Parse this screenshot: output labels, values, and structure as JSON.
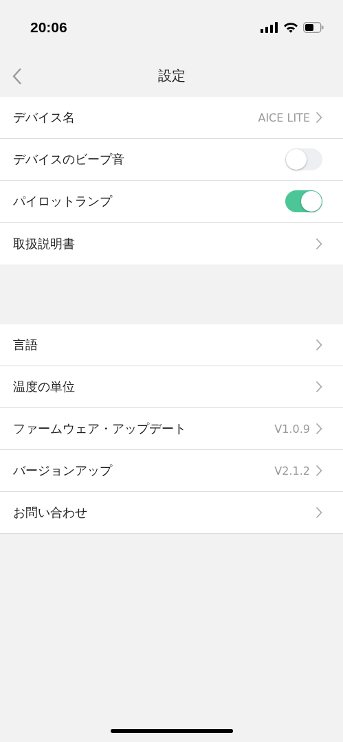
{
  "status_bar": {
    "time": "20:06"
  },
  "nav": {
    "title": "設定"
  },
  "sections": [
    {
      "rows": [
        {
          "kind": "link",
          "label": "デバイス名",
          "value": "AICE LITE"
        },
        {
          "kind": "toggle",
          "label": "デバイスのビープ音",
          "on": false
        },
        {
          "kind": "toggle",
          "label": "パイロットランプ",
          "on": true
        },
        {
          "kind": "link",
          "label": "取扱説明書"
        }
      ]
    },
    {
      "rows": [
        {
          "kind": "link",
          "label": "言語"
        },
        {
          "kind": "link",
          "label": "温度の単位"
        },
        {
          "kind": "link",
          "label": "ファームウェア・アップデート",
          "value": "V1.0.9"
        },
        {
          "kind": "link",
          "label": "バージョンアップ",
          "value": "V2.1.2"
        },
        {
          "kind": "link",
          "label": "お問い合わせ"
        }
      ]
    }
  ]
}
